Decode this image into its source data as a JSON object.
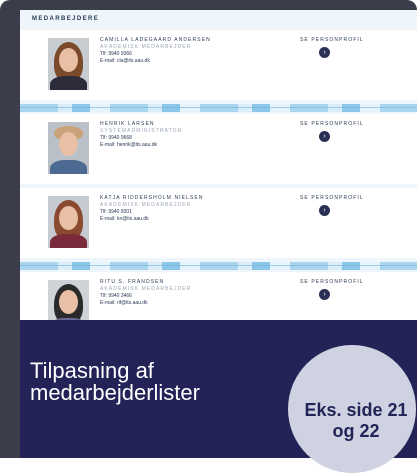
{
  "section_title": "MEDARBEJDERE",
  "staff": [
    {
      "name": "CAMILLA LADEGAARD ANDERSEN",
      "role": "AKADEMISK MEDARBEJDER",
      "phone": "Tlf: 9940 9366",
      "email": "E-mail: cla@its.aau.dk",
      "link_label": "SE PERSONPROFIL",
      "photo": {
        "bg": "#c7ccd1",
        "hair": "#7a4a2a",
        "body": "#2c2c3a"
      }
    },
    {
      "name": "HENRIK LARSEN",
      "role": "SYSTEMADMINISTRATOR",
      "phone": "Tlf: 9940 9668",
      "email": "E-mail: henrik@its.aau.dk",
      "link_label": "SE PERSONPROFIL",
      "photo": {
        "bg": "#b9c0c8",
        "hair": "#c9a27a",
        "body": "#4c6a92"
      }
    },
    {
      "name": "KATJA RIDDERSHOLM NIELSEN",
      "role": "AKADEMISK MEDARBEJDER",
      "phone": "Tlf: 9940 8301",
      "email": "E-mail: kn@its.aau.dk",
      "link_label": "SE PERSONPROFIL",
      "photo": {
        "bg": "#c5cbd0",
        "hair": "#8a4a30",
        "body": "#7a2a3a"
      }
    },
    {
      "name": "RITU S. FRANDSEN",
      "role": "AKADEMISK MEDARBEJDER",
      "phone": "Tlf: 9940 3466",
      "email": "E-mail: rif@its.aau.dk",
      "link_label": "SE PERSONPROFIL",
      "photo": {
        "bg": "#cfd3d8",
        "hair": "#2a2a2a",
        "body": "#6b6b9a"
      }
    }
  ],
  "banner": {
    "title": "Tilpasning af medarbejderlister",
    "badge": "Eks. side 21 og 22"
  },
  "colors": {
    "banner": "#232358",
    "button": "#2a2f55",
    "accent": "#7cbfe6"
  }
}
